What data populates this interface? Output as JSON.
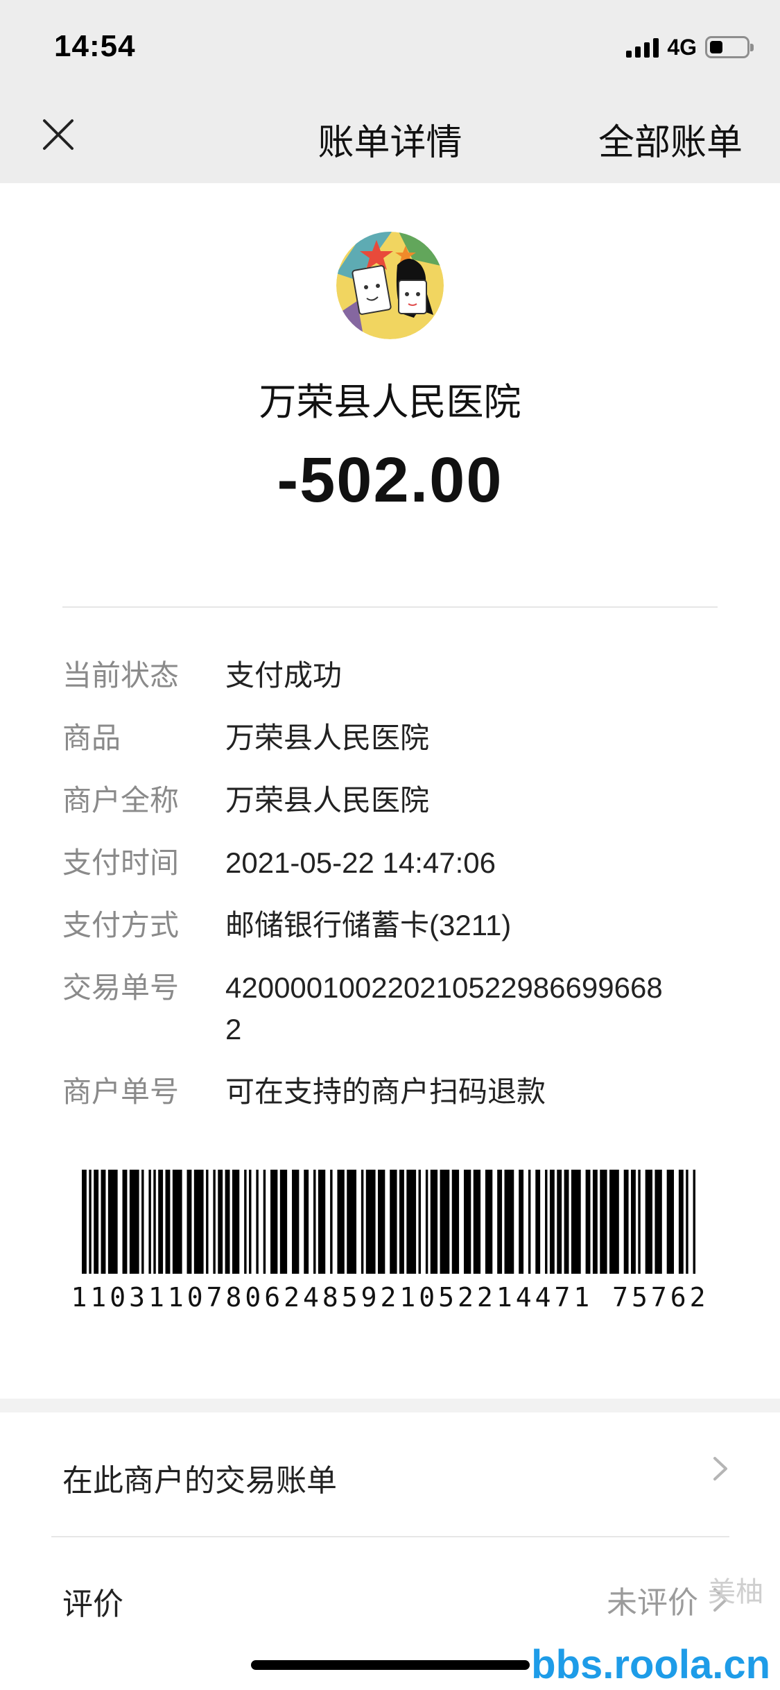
{
  "status_bar": {
    "time": "14:54",
    "network": "4G",
    "battery_level": 0.35
  },
  "nav": {
    "title": "账单详情",
    "right_label": "全部账单",
    "close_icon": "close-icon"
  },
  "merchant": {
    "name": "万荣县人民医院",
    "amount": "-502.00"
  },
  "details": [
    {
      "label": "当前状态",
      "value": "支付成功"
    },
    {
      "label": "商品",
      "value": "万荣县人民医院"
    },
    {
      "label": "商户全称",
      "value": "万荣县人民医院"
    },
    {
      "label": "支付时间",
      "value": "2021-05-22 14:47:06"
    },
    {
      "label": "支付方式",
      "value": "邮储银行储蓄卡(3211)"
    },
    {
      "label": "交易单号",
      "value": "4200001002202105229866996682"
    },
    {
      "label": "商户单号",
      "value": "可在支持的商户扫码退款"
    }
  ],
  "barcode": {
    "number": "110311078062485921052214471 75762"
  },
  "list": {
    "merchant_bills": {
      "label": "在此商户的交易账单",
      "icon": "chevron-right-icon"
    },
    "rating": {
      "label": "评价",
      "status": "未评价",
      "icon": "chevron-right-icon"
    }
  },
  "watermark": {
    "site": "bbs.roola.cn",
    "logo_text": "美柚"
  },
  "colors": {
    "header_bg": "#ededed",
    "label_gray": "#8a8a8a",
    "watermark_blue": "#1e9ce8"
  }
}
